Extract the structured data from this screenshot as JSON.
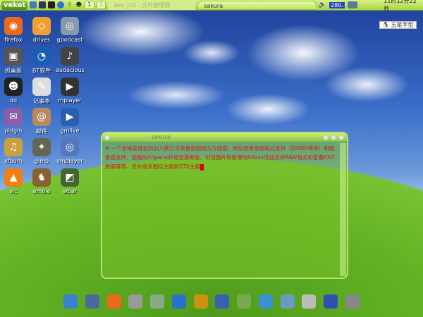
{
  "taskbar": {
    "logo": "veket",
    "workspaces": [
      "1",
      "2"
    ],
    "tasks": [
      {
        "label": "dev_ro2 - 文件管理器",
        "active": false
      },
      {
        "label": "sakura",
        "active": true
      }
    ],
    "cpu": "280.",
    "clock": "11时12分22秒",
    "quick_launch": [
      "install-icon",
      "gear-icon",
      "terminal-icon",
      "globe-icon",
      "search-icon",
      "qq-icon"
    ]
  },
  "ime": {
    "label": "五笔字型"
  },
  "desktop_icons": [
    {
      "label": "firefox",
      "color": "#e86a1a",
      "glyph": "◉"
    },
    {
      "label": "drives",
      "color": "#f0a030",
      "glyph": "◇"
    },
    {
      "label": "gpodcast",
      "color": "#8899aa",
      "glyph": "◎"
    },
    {
      "label": "抓桌面",
      "color": "#555555",
      "glyph": "▣"
    },
    {
      "label": "BT软件",
      "color": "#1a5fb4",
      "glyph": "◔"
    },
    {
      "label": "audacious",
      "color": "#444444",
      "glyph": "♪"
    },
    {
      "label": "qq",
      "color": "#222222",
      "glyph": "☻"
    },
    {
      "label": "记事本",
      "color": "#dddddd",
      "glyph": "✎"
    },
    {
      "label": "mplayer",
      "color": "#333333",
      "glyph": "▶"
    },
    {
      "label": "pidgin",
      "color": "#8a5fa8",
      "glyph": "✉"
    },
    {
      "label": "邮件",
      "color": "#b8895a",
      "glyph": "@"
    },
    {
      "label": "gmlive",
      "color": "#2a5fb0",
      "glyph": "▶"
    },
    {
      "label": "xfburn",
      "color": "#c8a040",
      "glyph": "♫"
    },
    {
      "label": "gimp",
      "color": "#666655",
      "glyph": "✦"
    },
    {
      "label": "smplayer",
      "color": "#5577bb",
      "glyph": "◎"
    },
    {
      "label": "vlc",
      "color": "#f08010",
      "glyph": "▲"
    },
    {
      "label": "emule",
      "color": "#8a6030",
      "glyph": "♞"
    },
    {
      "label": "wbar",
      "color": "#446633",
      "glyph": "◩"
    }
  ],
  "terminal": {
    "title": "sakura",
    "content": "# 一个音响发烧友的加入致力于改善音频的方方面面，例如改善音频格式支持（如MIDI等等）和图像音支持，画图的mtpaint升级至最新版，浏览图片和管理的fotoxx增加支持RAW格式和查看EXIF数据等等，另外增多图标主题和GTK主题"
  },
  "dock": [
    {
      "name": "finder-icon",
      "color": "#3a7fd0"
    },
    {
      "name": "monitor-icon",
      "color": "#4a6a9a"
    },
    {
      "name": "firefox-icon",
      "color": "#e86a1a"
    },
    {
      "name": "paper-icon",
      "color": "#999999"
    },
    {
      "name": "media-icon",
      "color": "#88aa88"
    },
    {
      "name": "globe-icon",
      "color": "#2a70d0"
    },
    {
      "name": "aim-icon",
      "color": "#d09010"
    },
    {
      "name": "document-icon",
      "color": "#3a60b0"
    },
    {
      "name": "window-icon",
      "color": "#7aa850"
    },
    {
      "name": "picture-icon",
      "color": "#3a90d0"
    },
    {
      "name": "satellite-icon",
      "color": "#6a9ac0"
    },
    {
      "name": "tux-icon",
      "color": "#bbbbbb"
    },
    {
      "name": "shield-help-icon",
      "color": "#3050b0"
    },
    {
      "name": "camera-icon",
      "color": "#888888"
    }
  ]
}
